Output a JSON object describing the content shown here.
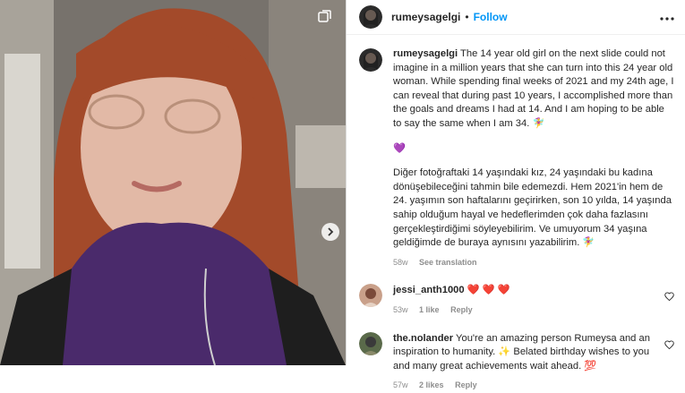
{
  "post": {
    "username": "rumeysagelgi",
    "separator": "•",
    "follow_label": "Follow",
    "more_label": "•••",
    "caption_en": "The 14 year old girl on the next slide could not imagine in a million years that she can turn into this 24 year old woman. While spending final weeks of 2021 and my 24th age, I can reveal that during past 10 years, I accomplished more than the goals and dreams I had at 14. And I am hoping to be able to say the same when I am 34. 🧚‍♀️",
    "caption_heart": "💜",
    "caption_tr": "Diğer fotoğraftaki 14 yaşındaki kız, 24 yaşındaki bu kadına dönüşebileceğini tahmin bile edemezdi. Hem 2021'in hem de 24. yaşımın son haftalarını geçirirken, son 10 yılda, 14 yaşında sahip olduğum hayal ve hedeflerimden çok daha fazlasını gerçekleştirdiğimi söyleyebilirim. Ve umuyorum 34 yaşına geldiğimde de buraya aynısını yazabilirim. 🧚‍♀️",
    "age": "58w",
    "see_translation": "See translation"
  },
  "comments": [
    {
      "username": "jessi_anth1000",
      "text": "❤️ ❤️ ❤️",
      "age": "53w",
      "likes": "1 like",
      "reply": "Reply"
    },
    {
      "username": "the.nolander",
      "text": "You're an amazing person Rumeysa and an inspiration to humanity. ✨ Belated birthday wishes to you and many great achievements wait ahead. 💯",
      "age": "57w",
      "likes": "2 likes",
      "reply": "Reply"
    }
  ],
  "colors": {
    "follow": "#0095f6",
    "text": "#262626",
    "muted": "#8e8e8e",
    "heart": "#ed4956",
    "sweater": "#4a2a6b"
  }
}
